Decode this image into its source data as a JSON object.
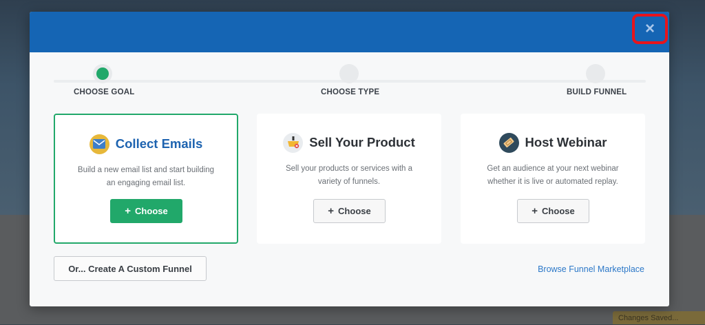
{
  "background": {
    "toast_text": "Changes Saved..."
  },
  "modal": {
    "close_label": "×",
    "steps": [
      {
        "label": "CHOOSE GOAL",
        "active": true
      },
      {
        "label": "CHOOSE TYPE",
        "active": false
      },
      {
        "label": "BUILD FUNNEL",
        "active": false
      }
    ],
    "cards": [
      {
        "title": "Collect Emails",
        "icon": "email-envelope-icon",
        "description": "Build a new email list and start building an engaging email list.",
        "button_label": "Choose",
        "selected": true
      },
      {
        "title": "Sell Your Product",
        "icon": "shopping-basket-icon",
        "description": "Sell your products or services with a variety of funnels.",
        "button_label": "Choose",
        "selected": false
      },
      {
        "title": "Host Webinar",
        "icon": "ticket-icon",
        "description": "Get an audience at your next webinar whether it is live or automated replay.",
        "button_label": "Choose",
        "selected": false
      }
    ],
    "custom_funnel_label": "Or... Create A Custom Funnel",
    "marketplace_link": "Browse Funnel Marketplace"
  },
  "colors": {
    "header_blue": "#1565b4",
    "accent_green": "#21a86a",
    "close_highlight_red": "#e8141b",
    "link_blue": "#2c78c8"
  }
}
